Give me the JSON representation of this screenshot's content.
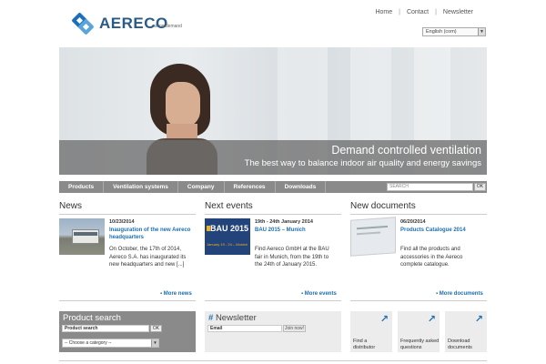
{
  "header": {
    "brand": "AERECO",
    "tagline": "air on demand",
    "links": [
      "Home",
      "Contact",
      "Newsletter"
    ],
    "language": "English (com)"
  },
  "hero": {
    "headline": "Demand controlled ventilation",
    "subheadline": "The best way to balance indoor air quality and energy savings"
  },
  "nav": {
    "items": [
      "Products",
      "Ventilation systems",
      "Company",
      "References",
      "Downloads"
    ],
    "search_placeholder": "SEARCH",
    "search_button": "OK"
  },
  "news": {
    "title": "News",
    "date": "10/23/2014",
    "headline": "Inauguration of the new Aereco headquarters",
    "body": "On October, the 17th of 2014, Aereco S.A. has inaugurated its new headquarters and new [...]",
    "more": "More news"
  },
  "events": {
    "title": "Next events",
    "date": "19th - 24th January 2014",
    "headline": "BAU 2015 – Munich",
    "body": "Find Aereco GmbH at the BAU fair in Munich, from the 19th to the 24th of January 2015.",
    "thumb_title": "BAU 2015",
    "thumb_dates": "January 19 - 24 – Munich",
    "more": "More events"
  },
  "documents": {
    "title": "New documents",
    "date": "06/20/2014",
    "headline": "Products Catalogue 2014",
    "body": "Find all the products and accessories in the Aereco complete catalogue.",
    "more": "More documents"
  },
  "product_search": {
    "title": "Product search",
    "input_value": "Product search",
    "ok": "OK",
    "category": "-- Choose a category --"
  },
  "newsletter": {
    "hash": "#",
    "title": "Newsletter",
    "input_value": "Email",
    "join": "Join now!"
  },
  "quick_links": [
    {
      "label": "Find a distributor",
      "icon": "arrow-up-right-icon"
    },
    {
      "label": "Frequently asked questions",
      "icon": "arrow-up-right-icon"
    },
    {
      "label": "Download documents",
      "icon": "arrow-up-right-icon"
    }
  ],
  "colors": {
    "link_blue": "#1d6fb1",
    "nav_gray": "#8a8a8a"
  }
}
